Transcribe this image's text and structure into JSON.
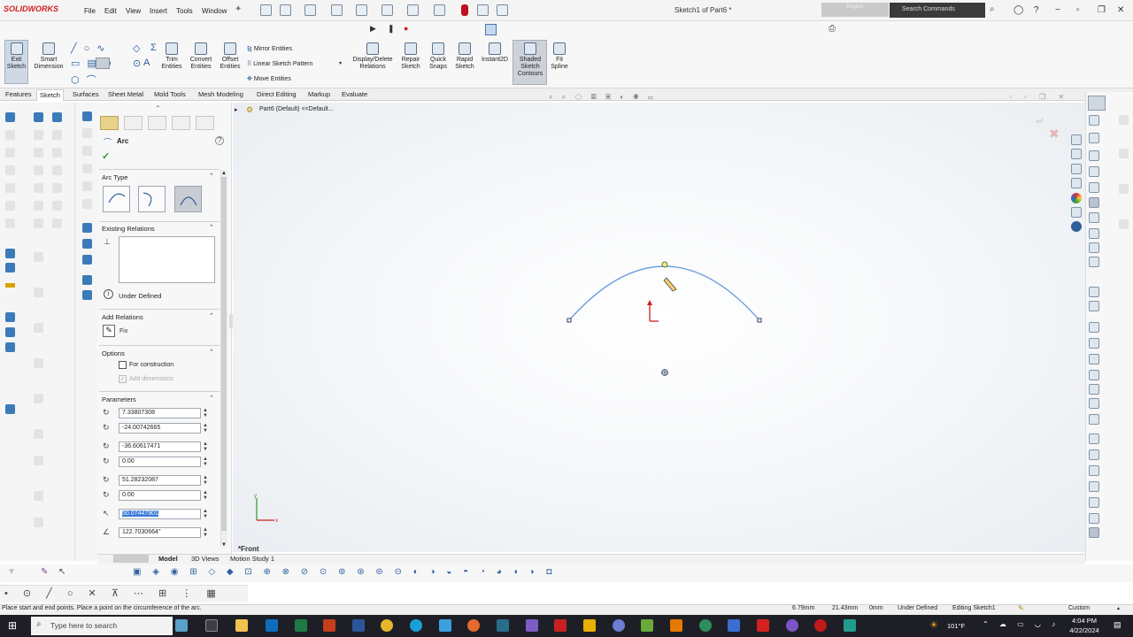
{
  "app": {
    "logo": "SOLIDWORKS",
    "menu": [
      "File",
      "Edit",
      "View",
      "Insert",
      "Tools",
      "Window"
    ],
    "window_title": "Sketch1 of Part6 *",
    "language_label": "English",
    "search_placeholder": "Search Commands"
  },
  "command_manager": {
    "exit_sketch": "Exit Sketch",
    "smart_dimension": "Smart Dimension",
    "trim_entities": "Trim Entities",
    "convert_entities": "Convert Entities",
    "offset_entities": "Offset Entities",
    "mirror_entities": "Mirror Entities",
    "linear_sketch_pattern": "Linear Sketch Pattern",
    "move_entities": "Move Entities",
    "display_delete_relations": "Display/Delete Relations",
    "repair_sketch": "Repair Sketch",
    "quick_snaps": "Quick Snaps",
    "rapid_sketch": "Rapid Sketch",
    "instant2d": "Instant2D",
    "shaded_sketch_contours": "Shaded Sketch Contours",
    "fit_spline": "Fit Spline"
  },
  "tabs": [
    "Features",
    "Sketch",
    "Surfaces",
    "Sheet Metal",
    "Mold Tools",
    "Mesh Modeling",
    "Direct Editing",
    "Markup",
    "Evaluate"
  ],
  "active_tab": "Sketch",
  "property_manager": {
    "title": "Arc",
    "arc_type_header": "Arc Type",
    "existing_relations_header": "Existing Relations",
    "status": "Under Defined",
    "add_relations_header": "Add Relations",
    "fix_label": "Fix",
    "options_header": "Options",
    "for_construction": "For construction",
    "add_dimensions": "Add dimensions",
    "parameters_header": "Parameters",
    "params": [
      "7.33807308",
      "-24.00742665",
      "-36.60617471",
      "0.00",
      "51.28232087",
      "0.00",
      "50.07447901",
      "122.7030664°"
    ]
  },
  "tree": {
    "root": "Part6 (Default) <<Default..."
  },
  "view_label": "*Front",
  "bottom_tabs": [
    "Model",
    "3D Views",
    "Motion Study 1"
  ],
  "status_bar": {
    "message": "Place start and end points. Place a point on the circumference of the arc.",
    "x": "6.79mm",
    "y": "21.43mm",
    "z": "0mm",
    "state": "Under Defined",
    "editing": "Editing Sketch1",
    "units": "Custom"
  },
  "taskbar": {
    "search": "Type here to search",
    "weather": "101°F",
    "time": "4:04 PM",
    "date": "4/22/2024"
  },
  "colors": {
    "arc": "#6f9fe0",
    "origin": "#cc2020",
    "selection": "#3b78d8"
  }
}
